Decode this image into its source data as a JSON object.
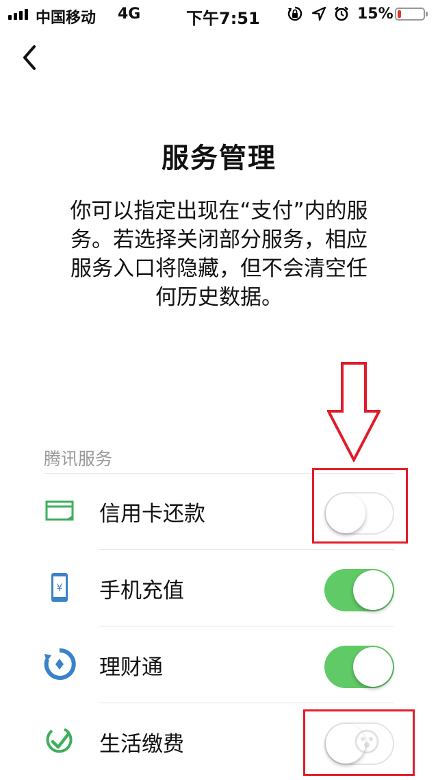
{
  "status_bar": {
    "carrier": "中国移动",
    "network": "4G",
    "time": "下午7:51",
    "battery_percent": "15%",
    "battery_level": 0.15,
    "icons": [
      "signal-bars-icon",
      "rotation-lock-icon",
      "location-arrow-icon",
      "alarm-clock-icon",
      "battery-icon"
    ]
  },
  "nav": {
    "back_icon": "chevron-left-icon"
  },
  "page": {
    "title": "服务管理",
    "description_lines": [
      "你可以指定出现在“支付”内的服",
      "务。若选择关闭部分服务，相应",
      "服务入口将隐藏，但不会清空任",
      "何历史数据。"
    ]
  },
  "section": {
    "label": "腾讯服务",
    "items": [
      {
        "label": "信用卡还款",
        "icon": "credit-card-icon",
        "enabled": false
      },
      {
        "label": "手机充值",
        "icon": "phone-topup-icon",
        "enabled": true
      },
      {
        "label": "理财通",
        "icon": "licaitong-icon",
        "enabled": true
      },
      {
        "label": "生活缴费",
        "icon": "utility-payment-icon",
        "enabled": false
      }
    ]
  },
  "colors": {
    "toggle_on": "#5fca66",
    "toggle_off_border": "#e3e3e3",
    "annotation_red": "#e11b2a",
    "battery_low": "#e0362c"
  }
}
